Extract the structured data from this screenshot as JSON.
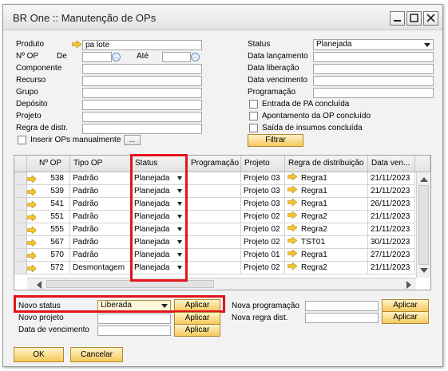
{
  "window": {
    "title": "BR One :: Manutenção de OPs"
  },
  "filters": {
    "produto_label": "Produto",
    "produto_value": "pa lote",
    "nop_label": "Nº OP",
    "de_label": "De",
    "ate_label": "Até",
    "componente_label": "Componente",
    "recurso_label": "Recurso",
    "grupo_label": "Grupo",
    "deposito_label": "Depósito",
    "projeto_label": "Projeto",
    "regra_label": "Regra de distr.",
    "inserir_label": "Inserir OPs manualmente",
    "browse_btn": "...",
    "status_label": "Status",
    "status_value": "Planejada",
    "data_lanc_label": "Data lançamento",
    "data_lib_label": "Data liberação",
    "data_venc_label": "Data vencimento",
    "programacao_label": "Programação",
    "entrada_label": "Entrada de PA concluída",
    "apontamento_label": "Apontamento da OP concluído",
    "saida_label": "Saída de insumos concluída",
    "filtrar_btn": "Filtrar"
  },
  "grid": {
    "columns": [
      "Nº OP",
      "Tipo OP",
      "Status",
      "Programação",
      "Projeto",
      "Regra de distribuição",
      "Data ven..."
    ],
    "rows": [
      {
        "nop": "538",
        "tipo": "Padrão",
        "status": "Planejada",
        "prog": "",
        "projeto": "Projeto 03",
        "regra": "Regra1",
        "data": "21/11/2023"
      },
      {
        "nop": "539",
        "tipo": "Padrão",
        "status": "Planejada",
        "prog": "",
        "projeto": "Projeto 03",
        "regra": "Regra1",
        "data": "21/11/2023"
      },
      {
        "nop": "541",
        "tipo": "Padrão",
        "status": "Planejada",
        "prog": "",
        "projeto": "Projeto 03",
        "regra": "Regra1",
        "data": "26/11/2023"
      },
      {
        "nop": "551",
        "tipo": "Padrão",
        "status": "Planejada",
        "prog": "",
        "projeto": "Projeto 02",
        "regra": "Regra2",
        "data": "21/11/2023"
      },
      {
        "nop": "555",
        "tipo": "Padrão",
        "status": "Planejada",
        "prog": "",
        "projeto": "Projeto 02",
        "regra": "Regra2",
        "data": "21/11/2023"
      },
      {
        "nop": "567",
        "tipo": "Padrão",
        "status": "Planejada",
        "prog": "",
        "projeto": "Projeto 02",
        "regra": "TST01",
        "data": "30/11/2023"
      },
      {
        "nop": "570",
        "tipo": "Padrão",
        "status": "Planejada",
        "prog": "",
        "projeto": "Projeto 01",
        "regra": "Regra1",
        "data": "27/11/2023"
      },
      {
        "nop": "572",
        "tipo": "Desmontagem",
        "status": "Planejada",
        "prog": "",
        "projeto": "Projeto 02",
        "regra": "Regra2",
        "data": "21/11/2023"
      }
    ]
  },
  "bottom": {
    "novo_status_label": "Novo status",
    "novo_status_value": "Liberada",
    "novo_projeto_label": "Novo projeto",
    "data_venc_label": "Data de vencimento",
    "nova_prog_label": "Nova programação",
    "nova_regra_label": "Nova regra dist.",
    "aplicar": "Aplicar"
  },
  "footer": {
    "ok": "OK",
    "cancelar": "Cancelar"
  },
  "colors": {
    "highlight": "#e3141b",
    "button_yellow": "#f5c95c",
    "arrow_yellow": "#f4c430"
  }
}
